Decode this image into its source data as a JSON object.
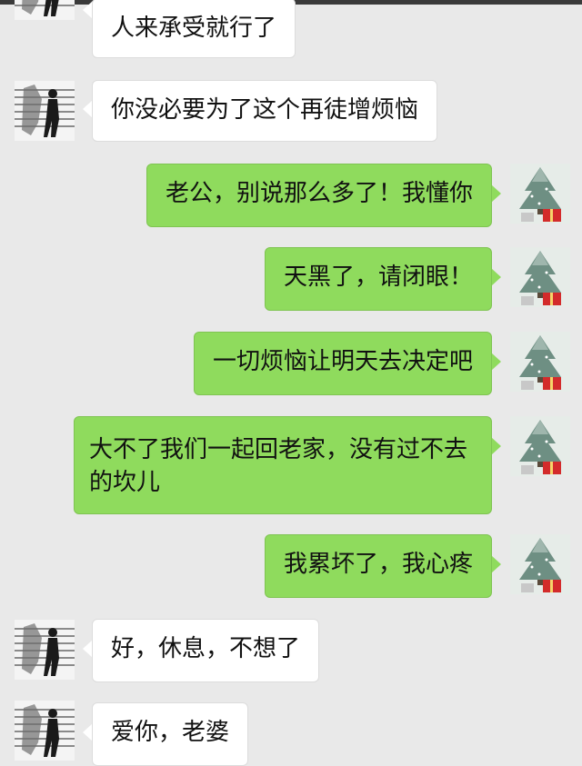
{
  "chat": {
    "messages": [
      {
        "side": "left",
        "text": "人来承受就行了"
      },
      {
        "side": "left",
        "text": "你没必要为了这个再徒增烦恼"
      },
      {
        "side": "right",
        "text": "老公，别说那么多了！我懂你"
      },
      {
        "side": "right",
        "text": "天黑了，请闭眼！"
      },
      {
        "side": "right",
        "text": "一切烦恼让明天去决定吧"
      },
      {
        "side": "right",
        "text": "大不了我们一起回老家，没有过不去的坎儿"
      },
      {
        "side": "right",
        "text": "我累坏了，我心疼"
      },
      {
        "side": "left",
        "text": "好，休息，不想了"
      },
      {
        "side": "left",
        "text": "爱你，老婆"
      }
    ]
  },
  "colors": {
    "background": "#e9e9e9",
    "incoming_bubble": "#ffffff",
    "outgoing_bubble": "#8fdb5d"
  },
  "icons": {
    "contact_avatar": "walking-man-avatar-icon",
    "self_avatar": "christmas-tree-avatar-icon"
  }
}
